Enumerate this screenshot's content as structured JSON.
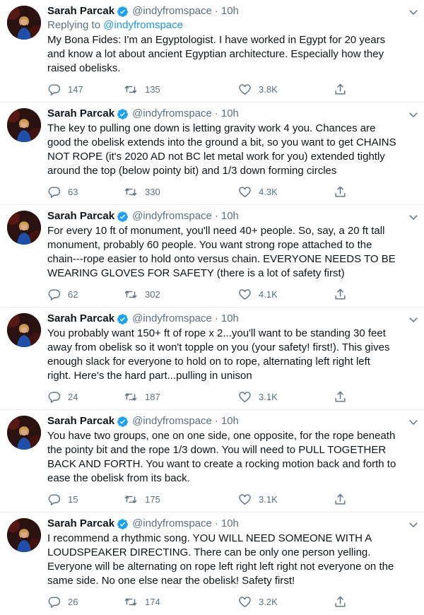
{
  "tweets": [
    {
      "name": "Sarah Parcak",
      "handle": "@indyfromspace",
      "dot": "·",
      "time": "10h",
      "replying_prefix": "Replying to ",
      "replying_handle": "@indyfromspace",
      "text": "My Bona Fides: I'm an Egyptologist. I have worked in Egypt for 20 years\nand know a lot about ancient Egyptian architecture. Especially how they\nraised obelisks.",
      "replies": "147",
      "retweets": "135",
      "likes": "3.8K"
    },
    {
      "name": "Sarah Parcak",
      "handle": "@indyfromspace",
      "dot": "·",
      "time": "10h",
      "text": "The key to pulling one down is letting gravity work 4 you. Chances are\ngood the obelisk extends into the ground a bit, so you want to get CHAINS\nNOT ROPE (it's 2020 AD not BC let metal work for you) extended tightly\naround the top (below pointy bit) and 1/3 down forming circles",
      "replies": "63",
      "retweets": "330",
      "likes": "4.3K"
    },
    {
      "name": "Sarah Parcak",
      "handle": "@indyfromspace",
      "dot": "·",
      "time": "10h",
      "text": "For every 10 ft of monument, you'll need 40+ people. So, say, a 20 ft tall\nmonument, probably 60 people. You want strong rope attached to the\nchain---rope easier to hold onto versus chain. EVERYONE NEEDS TO BE\nWEARING GLOVES FOR SAFETY (there is a lot of safety first)",
      "replies": "62",
      "retweets": "302",
      "likes": "4.1K"
    },
    {
      "name": "Sarah Parcak",
      "handle": "@indyfromspace",
      "dot": "·",
      "time": "10h",
      "text": "You probably want 150+ ft of rope x 2...you'll want to be standing 30 feet\naway from obelisk so it won't topple on you (your safety! first!). This gives\nenough slack for everyone to hold on to rope, alternating left right left\nright. Here's the hard part...pulling in unison",
      "replies": "24",
      "retweets": "187",
      "likes": "3.1K"
    },
    {
      "name": "Sarah Parcak",
      "handle": "@indyfromspace",
      "dot": "·",
      "time": "10h",
      "text": "You have two groups, one on one side, one opposite, for the rope beneath\nthe pointy bit and the rope 1/3 down. You will need to PULL TOGETHER\nBACK AND FORTH. You want to create a rocking motion back and forth to\nease the obelisk from its back.",
      "replies": "15",
      "retweets": "175",
      "likes": "3.1K"
    },
    {
      "name": "Sarah Parcak",
      "handle": "@indyfromspace",
      "dot": "·",
      "time": "10h",
      "text": "I recommend a rhythmic song. YOU WILL NEED SOMEONE WITH A\nLOUDSPEAKER DIRECTING. There can be only one person yelling.\nEveryone will be alternating on rope left right left right not everyone on the\nsame side. No one else near the obelisk! Safety first!",
      "replies": "26",
      "retweets": "174",
      "likes": "3.2K"
    }
  ],
  "icons": {
    "avatar": "avatar-photo",
    "verified": "verified-badge-icon",
    "caret": "chevron-down-icon",
    "reply": "reply-icon",
    "retweet": "retweet-icon",
    "like": "heart-icon",
    "share": "share-icon"
  },
  "colors": {
    "verified": "#1da1f2",
    "link": "#1b95e0",
    "secondary_text": "#5b7083",
    "primary_text": "#0f1419",
    "divider": "#e6ecf0"
  }
}
